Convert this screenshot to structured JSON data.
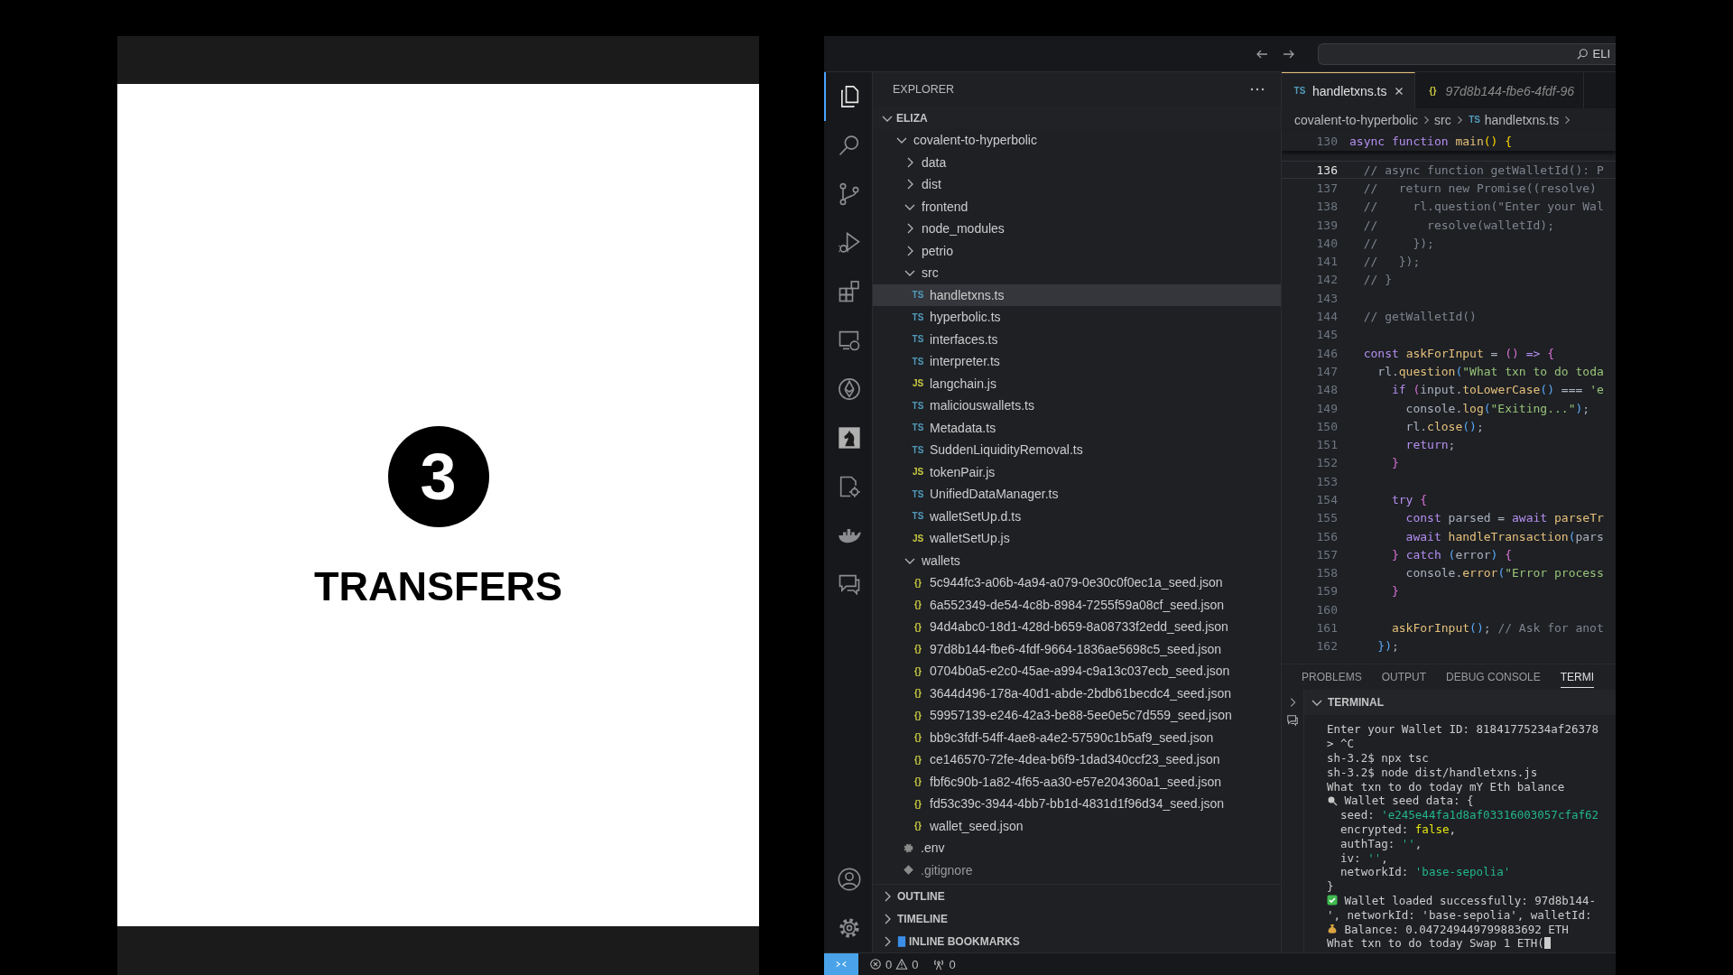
{
  "slide": {
    "step": "3",
    "title": "TRANSFERS"
  },
  "title_bar": {
    "search_text": "ELI"
  },
  "activity_bar": [
    {
      "kind": "files",
      "selected": true
    },
    {
      "kind": "search",
      "selected": false
    },
    {
      "kind": "source-control",
      "selected": false
    },
    {
      "kind": "run-debug",
      "selected": false
    },
    {
      "kind": "extensions",
      "selected": false
    },
    {
      "kind": "remote",
      "selected": false
    },
    {
      "kind": "ethereum",
      "selected": false
    },
    {
      "kind": "chess",
      "selected": false
    },
    {
      "kind": "cpp-gear",
      "selected": false
    },
    {
      "kind": "docker",
      "selected": false
    },
    {
      "kind": "comments",
      "selected": false
    }
  ],
  "activity_bar_bottom": [
    {
      "kind": "account"
    },
    {
      "kind": "settings"
    }
  ],
  "explorer": {
    "title": "EXPLORER",
    "workspace": {
      "name": "ELIZA",
      "expanded": true
    },
    "tree": [
      {
        "name": "covalent-to-hyperbolic",
        "kind": "folder",
        "expanded": true,
        "selected": false,
        "children": [
          {
            "name": "data",
            "kind": "folder",
            "expanded": false,
            "selected": false
          },
          {
            "name": "dist",
            "kind": "folder",
            "expanded": false,
            "selected": false
          },
          {
            "name": "frontend",
            "kind": "folder",
            "expanded": true,
            "selected": false
          },
          {
            "name": "node_modules",
            "kind": "folder",
            "expanded": false,
            "selected": false
          },
          {
            "name": "petrio",
            "kind": "folder",
            "expanded": false,
            "selected": false
          },
          {
            "name": "src",
            "kind": "folder",
            "expanded": true,
            "selected": false,
            "children": [
              {
                "name": "handletxns.ts",
                "kind": "ts",
                "badge": "TS",
                "selected": true
              },
              {
                "name": "hyperbolic.ts",
                "kind": "ts",
                "badge": "TS",
                "selected": false
              },
              {
                "name": "interfaces.ts",
                "kind": "ts",
                "badge": "TS",
                "selected": false
              },
              {
                "name": "interpreter.ts",
                "kind": "ts",
                "badge": "TS",
                "selected": false
              },
              {
                "name": "langchain.js",
                "kind": "js",
                "badge": "JS",
                "selected": false
              },
              {
                "name": "maliciouswallets.ts",
                "kind": "ts",
                "badge": "TS",
                "selected": false
              },
              {
                "name": "Metadata.ts",
                "kind": "ts",
                "badge": "TS",
                "selected": false
              },
              {
                "name": "SuddenLiquidityRemoval.ts",
                "kind": "ts",
                "badge": "TS",
                "selected": false
              },
              {
                "name": "tokenPair.js",
                "kind": "js",
                "badge": "JS",
                "selected": false
              },
              {
                "name": "UnifiedDataManager.ts",
                "kind": "ts",
                "badge": "TS",
                "selected": false
              },
              {
                "name": "walletSetUp.d.ts",
                "kind": "ts",
                "badge": "TS",
                "selected": false
              },
              {
                "name": "walletSetUp.js",
                "kind": "js",
                "badge": "JS",
                "selected": false
              }
            ]
          },
          {
            "name": "wallets",
            "kind": "folder",
            "expanded": true,
            "selected": false,
            "children": [
              {
                "name": "5c944fc3-a06b-4a94-a079-0e30c0f0ec1a_seed.json",
                "kind": "json",
                "badge": "{}",
                "selected": false
              },
              {
                "name": "6a552349-de54-4c8b-8984-7255f59a08cf_seed.json",
                "kind": "json",
                "badge": "{}",
                "selected": false
              },
              {
                "name": "94d4abc0-18d1-428d-b659-8a08733f2edd_seed.json",
                "kind": "json",
                "badge": "{}",
                "selected": false
              },
              {
                "name": "97d8b144-fbe6-4fdf-9664-1836ae5698c5_seed.json",
                "kind": "json",
                "badge": "{}",
                "selected": false
              },
              {
                "name": "0704b0a5-e2c0-45ae-a994-c9a13c037ecb_seed.json",
                "kind": "json",
                "badge": "{}",
                "selected": false
              },
              {
                "name": "3644d496-178a-40d1-abde-2bdb61becdc4_seed.json",
                "kind": "json",
                "badge": "{}",
                "selected": false
              },
              {
                "name": "59957139-e246-42a3-be88-5ee0e5c7d559_seed.json",
                "kind": "json",
                "badge": "{}",
                "selected": false
              },
              {
                "name": "bb9c3fdf-54ff-4ae8-a4e2-57590c1b5af9_seed.json",
                "kind": "json",
                "badge": "{}",
                "selected": false
              },
              {
                "name": "ce146570-72fe-4dea-b6f9-1dad340ccf23_seed.json",
                "kind": "json",
                "badge": "{}",
                "selected": false
              },
              {
                "name": "fbf6c90b-1a82-4f65-aa30-e57e204360a1_seed.json",
                "kind": "json",
                "badge": "{}",
                "selected": false
              },
              {
                "name": "fd53c39c-3944-4bb7-bb1d-4831d1f96d34_seed.json",
                "kind": "json",
                "badge": "{}",
                "selected": false
              },
              {
                "name": "wallet_seed.json",
                "kind": "json",
                "badge": "{}",
                "selected": false
              }
            ]
          },
          {
            "name": ".env",
            "kind": "env",
            "selected": false
          },
          {
            "name": ".gitignore",
            "kind": "git",
            "selected": false
          }
        ]
      }
    ],
    "sections": [
      {
        "name": "OUTLINE",
        "kind": "plain",
        "expanded": false
      },
      {
        "name": "TIMELINE",
        "kind": "plain",
        "expanded": false
      },
      {
        "name": "INLINE BOOKMARKS",
        "kind": "bookmarks",
        "expanded": false
      }
    ]
  },
  "editor": {
    "tabs": [
      {
        "name": "handletxns.ts",
        "badge": "TS",
        "kind": "ts",
        "selected": true,
        "preview": false
      },
      {
        "name": "97d8b144-fbe6-4fdf-96",
        "badge": "{}",
        "kind": "json",
        "selected": false,
        "preview": true
      }
    ],
    "breadcrumb": [
      {
        "text": "covalent-to-hyperbolic"
      },
      {
        "text": "src"
      },
      {
        "text": "handletxns.ts",
        "badge": "TS"
      }
    ],
    "sticky_line": {
      "number": "130",
      "tokens": [
        {
          "text": "async function ",
          "kind": "keyword"
        },
        {
          "text": "main",
          "kind": "function"
        },
        {
          "text": "() {",
          "kind": "bracket1"
        }
      ]
    },
    "lines": [
      {
        "number": "136",
        "current": true,
        "tokens": [
          {
            "text": "  // async function getWalletId(): P",
            "kind": "comment"
          }
        ]
      },
      {
        "number": "137",
        "current": false,
        "tokens": [
          {
            "text": "  //   return new Promise((resolve)",
            "kind": "comment"
          }
        ]
      },
      {
        "number": "138",
        "current": false,
        "tokens": [
          {
            "text": "  //     rl.question(\"Enter your Wal",
            "kind": "comment"
          }
        ]
      },
      {
        "number": "139",
        "current": false,
        "tokens": [
          {
            "text": "  //       resolve(walletId);",
            "kind": "comment"
          }
        ]
      },
      {
        "number": "140",
        "current": false,
        "tokens": [
          {
            "text": "  //     });",
            "kind": "comment"
          }
        ]
      },
      {
        "number": "141",
        "current": false,
        "tokens": [
          {
            "text": "  //   });",
            "kind": "comment"
          }
        ]
      },
      {
        "number": "142",
        "current": false,
        "tokens": [
          {
            "text": "  // }",
            "kind": "comment"
          }
        ]
      },
      {
        "number": "143",
        "current": false
      },
      {
        "number": "144",
        "current": false,
        "tokens": [
          {
            "text": "  // getWalletId()",
            "kind": "comment"
          }
        ]
      },
      {
        "number": "145",
        "current": false
      },
      {
        "number": "146",
        "current": false,
        "tokens": [
          {
            "text": "  const ",
            "kind": "keyword"
          },
          {
            "text": "askForInput",
            "kind": "function"
          },
          {
            "text": " = ",
            "kind": "plain"
          },
          {
            "text": "() ",
            "kind": "bracket2"
          },
          {
            "text": "=> ",
            "kind": "keyword"
          },
          {
            "text": "{",
            "kind": "bracket2"
          }
        ]
      },
      {
        "number": "147",
        "current": false,
        "tokens": [
          {
            "text": "    rl.",
            "kind": "plain"
          },
          {
            "text": "question",
            "kind": "function"
          },
          {
            "text": "(",
            "kind": "bracket3"
          },
          {
            "text": "\"What txn to do toda",
            "kind": "string"
          }
        ]
      },
      {
        "number": "148",
        "current": false,
        "tokens": [
          {
            "text": "      if ",
            "kind": "keyword"
          },
          {
            "text": "(",
            "kind": "bracket2"
          },
          {
            "text": "input.",
            "kind": "plain"
          },
          {
            "text": "toLowerCase",
            "kind": "function"
          },
          {
            "text": "()",
            "kind": "bracket3"
          },
          {
            "text": " === ",
            "kind": "plain"
          },
          {
            "text": "'e",
            "kind": "string"
          }
        ]
      },
      {
        "number": "149",
        "current": false,
        "tokens": [
          {
            "text": "        console.",
            "kind": "plain"
          },
          {
            "text": "log",
            "kind": "function"
          },
          {
            "text": "(",
            "kind": "bracket3"
          },
          {
            "text": "\"Exiting...\"",
            "kind": "string"
          },
          {
            "text": ")",
            "kind": "bracket3"
          },
          {
            "text": ";",
            "kind": "plain"
          }
        ]
      },
      {
        "number": "150",
        "current": false,
        "tokens": [
          {
            "text": "        rl.",
            "kind": "plain"
          },
          {
            "text": "close",
            "kind": "function"
          },
          {
            "text": "()",
            "kind": "bracket3"
          },
          {
            "text": ";",
            "kind": "plain"
          }
        ]
      },
      {
        "number": "151",
        "current": false,
        "tokens": [
          {
            "text": "        return",
            "kind": "keyword"
          },
          {
            "text": ";",
            "kind": "plain"
          }
        ]
      },
      {
        "number": "152",
        "current": false,
        "tokens": [
          {
            "text": "      }",
            "kind": "bracket2"
          }
        ]
      },
      {
        "number": "153",
        "current": false
      },
      {
        "number": "154",
        "current": false,
        "tokens": [
          {
            "text": "      try ",
            "kind": "keyword"
          },
          {
            "text": "{",
            "kind": "bracket2"
          }
        ]
      },
      {
        "number": "155",
        "current": false,
        "tokens": [
          {
            "text": "        const ",
            "kind": "keyword"
          },
          {
            "text": "parsed = ",
            "kind": "plain"
          },
          {
            "text": "await ",
            "kind": "keyword"
          },
          {
            "text": "parseTr",
            "kind": "function"
          }
        ]
      },
      {
        "number": "156",
        "current": false,
        "tokens": [
          {
            "text": "        await ",
            "kind": "keyword"
          },
          {
            "text": "handleTransaction",
            "kind": "function"
          },
          {
            "text": "(",
            "kind": "bracket3"
          },
          {
            "text": "pars",
            "kind": "plain"
          }
        ]
      },
      {
        "number": "157",
        "current": false,
        "tokens": [
          {
            "text": "      } ",
            "kind": "bracket2"
          },
          {
            "text": "catch ",
            "kind": "keyword"
          },
          {
            "text": "(",
            "kind": "bracket3"
          },
          {
            "text": "error",
            "kind": "plain"
          },
          {
            "text": ") ",
            "kind": "bracket3"
          },
          {
            "text": "{",
            "kind": "bracket2"
          }
        ]
      },
      {
        "number": "158",
        "current": false,
        "tokens": [
          {
            "text": "        console.",
            "kind": "plain"
          },
          {
            "text": "error",
            "kind": "function"
          },
          {
            "text": "(",
            "kind": "bracket3"
          },
          {
            "text": "\"Error process",
            "kind": "string"
          }
        ]
      },
      {
        "number": "159",
        "current": false,
        "tokens": [
          {
            "text": "      }",
            "kind": "bracket2"
          }
        ]
      },
      {
        "number": "160",
        "current": false
      },
      {
        "number": "161",
        "current": false,
        "tokens": [
          {
            "text": "      askForInput",
            "kind": "function"
          },
          {
            "text": "()",
            "kind": "bracket3"
          },
          {
            "text": "; ",
            "kind": "plain"
          },
          {
            "text": "// Ask for anot",
            "kind": "comment"
          }
        ]
      },
      {
        "number": "162",
        "current": false,
        "tokens": [
          {
            "text": "    })",
            "kind": "bracket3"
          },
          {
            "text": ";",
            "kind": "plain"
          }
        ]
      }
    ]
  },
  "panel": {
    "tabs": [
      {
        "label": "PROBLEMS",
        "selected": false
      },
      {
        "label": "OUTPUT",
        "selected": false
      },
      {
        "label": "DEBUG CONSOLE",
        "selected": false
      },
      {
        "label": "TERMI",
        "selected": true
      }
    ],
    "terminal": {
      "title": "TERMINAL",
      "expanded": true,
      "lines": [
        {
          "tokens": [
            {
              "text": "Enter your Wallet ID: 81841775234af26378",
              "kind": "plain"
            }
          ]
        },
        {
          "tokens": [
            {
              "text": "> ^C",
              "kind": "plain"
            }
          ]
        },
        {
          "tokens": [
            {
              "text": "sh-3.2$ npx tsc",
              "kind": "plain"
            }
          ]
        },
        {
          "tokens": [
            {
              "text": "sh-3.2$ node dist/handletxns.js",
              "kind": "plain"
            }
          ]
        },
        {
          "tokens": [
            {
              "text": "What txn to do today mY Eth balance",
              "kind": "plain"
            }
          ]
        },
        {
          "kind": "search",
          "tokens": [
            {
              "text": " Wallet seed data: {",
              "kind": "plain"
            }
          ]
        },
        {
          "tokens": [
            {
              "text": "  seed: ",
              "kind": "plain"
            },
            {
              "text": "'e245e44fa1d8af03316003057cfaf62",
              "kind": "string"
            }
          ]
        },
        {
          "tokens": [
            {
              "text": "  encrypted: ",
              "kind": "plain"
            },
            {
              "text": "false",
              "kind": "bool"
            },
            {
              "text": ",",
              "kind": "plain"
            }
          ]
        },
        {
          "tokens": [
            {
              "text": "  authTag: ",
              "kind": "plain"
            },
            {
              "text": "''",
              "kind": "string"
            },
            {
              "text": ",",
              "kind": "plain"
            }
          ]
        },
        {
          "tokens": [
            {
              "text": "  iv: ",
              "kind": "plain"
            },
            {
              "text": "''",
              "kind": "string"
            },
            {
              "text": ",",
              "kind": "plain"
            }
          ]
        },
        {
          "tokens": [
            {
              "text": "  networkId: ",
              "kind": "plain"
            },
            {
              "text": "'base-sepolia'",
              "kind": "string"
            }
          ]
        },
        {
          "tokens": [
            {
              "text": "}",
              "kind": "plain"
            }
          ]
        },
        {
          "kind": "check",
          "tokens": [
            {
              "text": " Wallet loaded successfully: 97d8b144-",
              "kind": "plain"
            }
          ]
        },
        {
          "tokens": [
            {
              "text": "', networkId: 'base-sepolia', walletId:",
              "kind": "plain"
            }
          ]
        },
        {
          "kind": "bag",
          "tokens": [
            {
              "text": " Balance: 0.047249449799883692 ETH",
              "kind": "plain"
            }
          ]
        },
        {
          "cursor": true,
          "tokens": [
            {
              "text": "What txn to do today Swap 1 ETH(",
              "kind": "plain"
            }
          ]
        }
      ]
    }
  },
  "status_bar": {
    "errors": "0",
    "warnings": "0",
    "ports": "0"
  }
}
